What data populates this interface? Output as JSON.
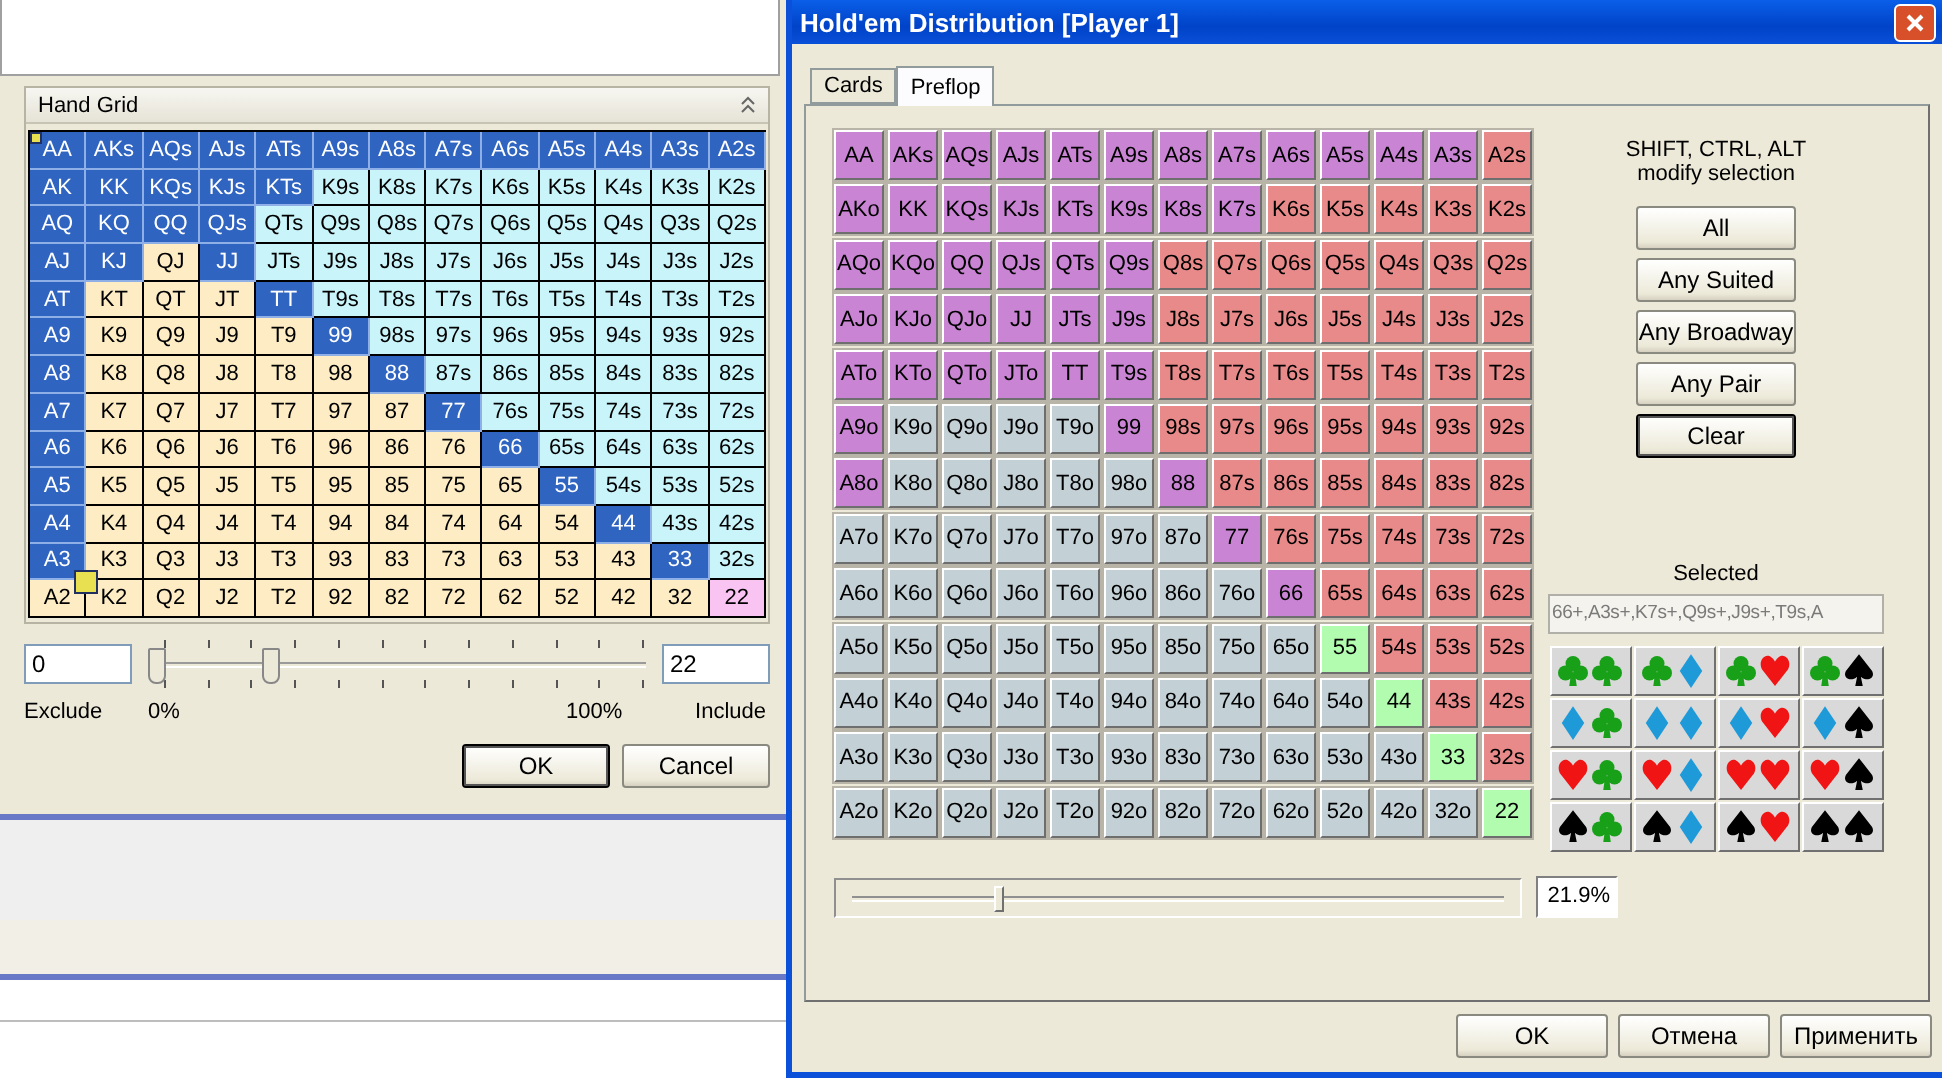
{
  "hand_grid_panel": {
    "header": "Hand Grid",
    "rows": [
      [
        {
          "label": "AA",
          "color": "#2f64c1"
        },
        {
          "label": "AKs",
          "color": "#2f64c1"
        },
        {
          "label": "AQs",
          "color": "#2f64c1"
        },
        {
          "label": "AJs",
          "color": "#2f64c1"
        },
        {
          "label": "ATs",
          "color": "#2f64c1"
        },
        {
          "label": "A9s",
          "color": "#2f64c1"
        },
        {
          "label": "A8s",
          "color": "#2f64c1"
        },
        {
          "label": "A7s",
          "color": "#2f64c1"
        },
        {
          "label": "A6s",
          "color": "#2f64c1"
        },
        {
          "label": "A5s",
          "color": "#2f64c1"
        },
        {
          "label": "A4s",
          "color": "#2f64c1"
        },
        {
          "label": "A3s",
          "color": "#2f64c1"
        },
        {
          "label": "A2s",
          "color": "#2f64c1"
        }
      ],
      [
        {
          "label": "AK",
          "color": "#2f64c1"
        },
        {
          "label": "KK",
          "color": "#2f64c1"
        },
        {
          "label": "KQs",
          "color": "#2f64c1"
        },
        {
          "label": "KJs",
          "color": "#2f64c1"
        },
        {
          "label": "KTs",
          "color": "#2f64c1"
        },
        {
          "label": "K9s",
          "color": "#c8f4fa"
        },
        {
          "label": "K8s",
          "color": "#c8f4fa"
        },
        {
          "label": "K7s",
          "color": "#c8f4fa"
        },
        {
          "label": "K6s",
          "color": "#c8f4fa"
        },
        {
          "label": "K5s",
          "color": "#c8f4fa"
        },
        {
          "label": "K4s",
          "color": "#c8f4fa"
        },
        {
          "label": "K3s",
          "color": "#c8f4fa"
        },
        {
          "label": "K2s",
          "color": "#c8f4fa"
        }
      ],
      [
        {
          "label": "AQ",
          "color": "#2f64c1"
        },
        {
          "label": "KQ",
          "color": "#2f64c1"
        },
        {
          "label": "QQ",
          "color": "#2f64c1"
        },
        {
          "label": "QJs",
          "color": "#2f64c1"
        },
        {
          "label": "QTs",
          "color": "#c8f4fa"
        },
        {
          "label": "Q9s",
          "color": "#c8f4fa"
        },
        {
          "label": "Q8s",
          "color": "#c8f4fa"
        },
        {
          "label": "Q7s",
          "color": "#c8f4fa"
        },
        {
          "label": "Q6s",
          "color": "#c8f4fa"
        },
        {
          "label": "Q5s",
          "color": "#c8f4fa"
        },
        {
          "label": "Q4s",
          "color": "#c8f4fa"
        },
        {
          "label": "Q3s",
          "color": "#c8f4fa"
        },
        {
          "label": "Q2s",
          "color": "#c8f4fa"
        }
      ],
      [
        {
          "label": "AJ",
          "color": "#2f64c1"
        },
        {
          "label": "KJ",
          "color": "#2f64c1"
        },
        {
          "label": "QJ",
          "color": "#fdecc4"
        },
        {
          "label": "JJ",
          "color": "#2f64c1"
        },
        {
          "label": "JTs",
          "color": "#c8f4fa"
        },
        {
          "label": "J9s",
          "color": "#c8f4fa"
        },
        {
          "label": "J8s",
          "color": "#c8f4fa"
        },
        {
          "label": "J7s",
          "color": "#c8f4fa"
        },
        {
          "label": "J6s",
          "color": "#c8f4fa"
        },
        {
          "label": "J5s",
          "color": "#c8f4fa"
        },
        {
          "label": "J4s",
          "color": "#c8f4fa"
        },
        {
          "label": "J3s",
          "color": "#c8f4fa"
        },
        {
          "label": "J2s",
          "color": "#c8f4fa"
        }
      ],
      [
        {
          "label": "AT",
          "color": "#2f64c1"
        },
        {
          "label": "KT",
          "color": "#fdecc4"
        },
        {
          "label": "QT",
          "color": "#fdecc4"
        },
        {
          "label": "JT",
          "color": "#fdecc4"
        },
        {
          "label": "TT",
          "color": "#2f64c1"
        },
        {
          "label": "T9s",
          "color": "#c8f4fa"
        },
        {
          "label": "T8s",
          "color": "#c8f4fa"
        },
        {
          "label": "T7s",
          "color": "#c8f4fa"
        },
        {
          "label": "T6s",
          "color": "#c8f4fa"
        },
        {
          "label": "T5s",
          "color": "#c8f4fa"
        },
        {
          "label": "T4s",
          "color": "#c8f4fa"
        },
        {
          "label": "T3s",
          "color": "#c8f4fa"
        },
        {
          "label": "T2s",
          "color": "#c8f4fa"
        }
      ],
      [
        {
          "label": "A9",
          "color": "#2f64c1"
        },
        {
          "label": "K9",
          "color": "#fdecc4"
        },
        {
          "label": "Q9",
          "color": "#fdecc4"
        },
        {
          "label": "J9",
          "color": "#fdecc4"
        },
        {
          "label": "T9",
          "color": "#fdecc4"
        },
        {
          "label": "99",
          "color": "#2f64c1"
        },
        {
          "label": "98s",
          "color": "#c8f4fa"
        },
        {
          "label": "97s",
          "color": "#c8f4fa"
        },
        {
          "label": "96s",
          "color": "#c8f4fa"
        },
        {
          "label": "95s",
          "color": "#c8f4fa"
        },
        {
          "label": "94s",
          "color": "#c8f4fa"
        },
        {
          "label": "93s",
          "color": "#c8f4fa"
        },
        {
          "label": "92s",
          "color": "#c8f4fa"
        }
      ],
      [
        {
          "label": "A8",
          "color": "#2f64c1"
        },
        {
          "label": "K8",
          "color": "#fdecc4"
        },
        {
          "label": "Q8",
          "color": "#fdecc4"
        },
        {
          "label": "J8",
          "color": "#fdecc4"
        },
        {
          "label": "T8",
          "color": "#fdecc4"
        },
        {
          "label": "98",
          "color": "#fdecc4"
        },
        {
          "label": "88",
          "color": "#2f64c1"
        },
        {
          "label": "87s",
          "color": "#c8f4fa"
        },
        {
          "label": "86s",
          "color": "#c8f4fa"
        },
        {
          "label": "85s",
          "color": "#c8f4fa"
        },
        {
          "label": "84s",
          "color": "#c8f4fa"
        },
        {
          "label": "83s",
          "color": "#c8f4fa"
        },
        {
          "label": "82s",
          "color": "#c8f4fa"
        }
      ],
      [
        {
          "label": "A7",
          "color": "#2f64c1"
        },
        {
          "label": "K7",
          "color": "#fdecc4"
        },
        {
          "label": "Q7",
          "color": "#fdecc4"
        },
        {
          "label": "J7",
          "color": "#fdecc4"
        },
        {
          "label": "T7",
          "color": "#fdecc4"
        },
        {
          "label": "97",
          "color": "#fdecc4"
        },
        {
          "label": "87",
          "color": "#fdecc4"
        },
        {
          "label": "77",
          "color": "#2f64c1"
        },
        {
          "label": "76s",
          "color": "#c8f4fa"
        },
        {
          "label": "75s",
          "color": "#c8f4fa"
        },
        {
          "label": "74s",
          "color": "#c8f4fa"
        },
        {
          "label": "73s",
          "color": "#c8f4fa"
        },
        {
          "label": "72s",
          "color": "#c8f4fa"
        }
      ],
      [
        {
          "label": "A6",
          "color": "#2f64c1"
        },
        {
          "label": "K6",
          "color": "#fdecc4"
        },
        {
          "label": "Q6",
          "color": "#fdecc4"
        },
        {
          "label": "J6",
          "color": "#fdecc4"
        },
        {
          "label": "T6",
          "color": "#fdecc4"
        },
        {
          "label": "96",
          "color": "#fdecc4"
        },
        {
          "label": "86",
          "color": "#fdecc4"
        },
        {
          "label": "76",
          "color": "#fdecc4"
        },
        {
          "label": "66",
          "color": "#2f64c1"
        },
        {
          "label": "65s",
          "color": "#c8f4fa"
        },
        {
          "label": "64s",
          "color": "#c8f4fa"
        },
        {
          "label": "63s",
          "color": "#c8f4fa"
        },
        {
          "label": "62s",
          "color": "#c8f4fa"
        }
      ],
      [
        {
          "label": "A5",
          "color": "#2f64c1"
        },
        {
          "label": "K5",
          "color": "#fdecc4"
        },
        {
          "label": "Q5",
          "color": "#fdecc4"
        },
        {
          "label": "J5",
          "color": "#fdecc4"
        },
        {
          "label": "T5",
          "color": "#fdecc4"
        },
        {
          "label": "95",
          "color": "#fdecc4"
        },
        {
          "label": "85",
          "color": "#fdecc4"
        },
        {
          "label": "75",
          "color": "#fdecc4"
        },
        {
          "label": "65",
          "color": "#fdecc4"
        },
        {
          "label": "55",
          "color": "#2f64c1"
        },
        {
          "label": "54s",
          "color": "#c8f4fa"
        },
        {
          "label": "53s",
          "color": "#c8f4fa"
        },
        {
          "label": "52s",
          "color": "#c8f4fa"
        }
      ],
      [
        {
          "label": "A4",
          "color": "#2f64c1"
        },
        {
          "label": "K4",
          "color": "#fdecc4"
        },
        {
          "label": "Q4",
          "color": "#fdecc4"
        },
        {
          "label": "J4",
          "color": "#fdecc4"
        },
        {
          "label": "T4",
          "color": "#fdecc4"
        },
        {
          "label": "94",
          "color": "#fdecc4"
        },
        {
          "label": "84",
          "color": "#fdecc4"
        },
        {
          "label": "74",
          "color": "#fdecc4"
        },
        {
          "label": "64",
          "color": "#fdecc4"
        },
        {
          "label": "54",
          "color": "#fdecc4"
        },
        {
          "label": "44",
          "color": "#2f64c1"
        },
        {
          "label": "43s",
          "color": "#c8f4fa"
        },
        {
          "label": "42s",
          "color": "#c8f4fa"
        }
      ],
      [
        {
          "label": "A3",
          "color": "#2f64c1"
        },
        {
          "label": "K3",
          "color": "#fdecc4"
        },
        {
          "label": "Q3",
          "color": "#fdecc4"
        },
        {
          "label": "J3",
          "color": "#fdecc4"
        },
        {
          "label": "T3",
          "color": "#fdecc4"
        },
        {
          "label": "93",
          "color": "#fdecc4"
        },
        {
          "label": "83",
          "color": "#fdecc4"
        },
        {
          "label": "73",
          "color": "#fdecc4"
        },
        {
          "label": "63",
          "color": "#fdecc4"
        },
        {
          "label": "53",
          "color": "#fdecc4"
        },
        {
          "label": "43",
          "color": "#fdecc4"
        },
        {
          "label": "33",
          "color": "#2f64c1"
        },
        {
          "label": "32s",
          "color": "#c8f4fa"
        }
      ],
      [
        {
          "label": "A2",
          "color": "#fdecc4"
        },
        {
          "label": "K2",
          "color": "#fdecc4"
        },
        {
          "label": "Q2",
          "color": "#fdecc4"
        },
        {
          "label": "J2",
          "color": "#fdecc4"
        },
        {
          "label": "T2",
          "color": "#fdecc4"
        },
        {
          "label": "92",
          "color": "#fdecc4"
        },
        {
          "label": "82",
          "color": "#fdecc4"
        },
        {
          "label": "72",
          "color": "#fdecc4"
        },
        {
          "label": "62",
          "color": "#fdecc4"
        },
        {
          "label": "52",
          "color": "#fdecc4"
        },
        {
          "label": "42",
          "color": "#fdecc4"
        },
        {
          "label": "32",
          "color": "#fdecc4"
        },
        {
          "label": "22",
          "color": "#f9c4f2"
        }
      ]
    ],
    "exclude_field": {
      "value": "0"
    },
    "range_slider": {
      "thumbs": [
        {
          "level": 0
        },
        {
          "level": 0.24
        }
      ]
    },
    "include_field": {
      "value": "22"
    },
    "labels": {
      "exclude": "Exclude",
      "min": "0%",
      "max": "100%",
      "include": "Include"
    },
    "buttons": [
      "OK",
      "Cancel"
    ]
  },
  "dialog": {
    "title": "Hold'em Distribution [Player 1]",
    "tabs": [
      {
        "label": "Cards",
        "selected": false
      },
      {
        "label": "Preflop",
        "selected": true
      }
    ],
    "rows": [
      [
        {
          "label": "AA",
          "color": "#c985d3"
        },
        {
          "label": "AKs",
          "color": "#c985d3"
        },
        {
          "label": "AQs",
          "color": "#c985d3"
        },
        {
          "label": "AJs",
          "color": "#c985d3"
        },
        {
          "label": "ATs",
          "color": "#c985d3"
        },
        {
          "label": "A9s",
          "color": "#c985d3"
        },
        {
          "label": "A8s",
          "color": "#c985d3"
        },
        {
          "label": "A7s",
          "color": "#c985d3"
        },
        {
          "label": "A6s",
          "color": "#c985d3"
        },
        {
          "label": "A5s",
          "color": "#c985d3"
        },
        {
          "label": "A4s",
          "color": "#c985d3"
        },
        {
          "label": "A3s",
          "color": "#c985d3"
        },
        {
          "label": "A2s",
          "color": "#e88a8a"
        }
      ],
      [
        {
          "label": "AKo",
          "color": "#c985d3"
        },
        {
          "label": "KK",
          "color": "#c985d3"
        },
        {
          "label": "KQs",
          "color": "#c985d3"
        },
        {
          "label": "KJs",
          "color": "#c985d3"
        },
        {
          "label": "KTs",
          "color": "#c985d3"
        },
        {
          "label": "K9s",
          "color": "#c985d3"
        },
        {
          "label": "K8s",
          "color": "#c985d3"
        },
        {
          "label": "K7s",
          "color": "#c985d3"
        },
        {
          "label": "K6s",
          "color": "#e88a8a"
        },
        {
          "label": "K5s",
          "color": "#e88a8a"
        },
        {
          "label": "K4s",
          "color": "#e88a8a"
        },
        {
          "label": "K3s",
          "color": "#e88a8a"
        },
        {
          "label": "K2s",
          "color": "#e88a8a"
        }
      ],
      [
        {
          "label": "AQo",
          "color": "#c985d3"
        },
        {
          "label": "KQo",
          "color": "#c985d3"
        },
        {
          "label": "QQ",
          "color": "#c985d3"
        },
        {
          "label": "QJs",
          "color": "#c985d3"
        },
        {
          "label": "QTs",
          "color": "#c985d3"
        },
        {
          "label": "Q9s",
          "color": "#c985d3"
        },
        {
          "label": "Q8s",
          "color": "#e88a8a"
        },
        {
          "label": "Q7s",
          "color": "#e88a8a"
        },
        {
          "label": "Q6s",
          "color": "#e88a8a"
        },
        {
          "label": "Q5s",
          "color": "#e88a8a"
        },
        {
          "label": "Q4s",
          "color": "#e88a8a"
        },
        {
          "label": "Q3s",
          "color": "#e88a8a"
        },
        {
          "label": "Q2s",
          "color": "#e88a8a"
        }
      ],
      [
        {
          "label": "AJo",
          "color": "#c985d3"
        },
        {
          "label": "KJo",
          "color": "#c985d3"
        },
        {
          "label": "QJo",
          "color": "#c985d3"
        },
        {
          "label": "JJ",
          "color": "#c985d3"
        },
        {
          "label": "JTs",
          "color": "#c985d3"
        },
        {
          "label": "J9s",
          "color": "#c985d3"
        },
        {
          "label": "J8s",
          "color": "#e88a8a"
        },
        {
          "label": "J7s",
          "color": "#e88a8a"
        },
        {
          "label": "J6s",
          "color": "#e88a8a"
        },
        {
          "label": "J5s",
          "color": "#e88a8a"
        },
        {
          "label": "J4s",
          "color": "#e88a8a"
        },
        {
          "label": "J3s",
          "color": "#e88a8a"
        },
        {
          "label": "J2s",
          "color": "#e88a8a"
        }
      ],
      [
        {
          "label": "ATo",
          "color": "#c985d3"
        },
        {
          "label": "KTo",
          "color": "#c985d3"
        },
        {
          "label": "QTo",
          "color": "#c985d3"
        },
        {
          "label": "JTo",
          "color": "#c985d3"
        },
        {
          "label": "TT",
          "color": "#c985d3"
        },
        {
          "label": "T9s",
          "color": "#c985d3"
        },
        {
          "label": "T8s",
          "color": "#e88a8a"
        },
        {
          "label": "T7s",
          "color": "#e88a8a"
        },
        {
          "label": "T6s",
          "color": "#e88a8a"
        },
        {
          "label": "T5s",
          "color": "#e88a8a"
        },
        {
          "label": "T4s",
          "color": "#e88a8a"
        },
        {
          "label": "T3s",
          "color": "#e88a8a"
        },
        {
          "label": "T2s",
          "color": "#e88a8a"
        }
      ],
      [
        {
          "label": "A9o",
          "color": "#c985d3"
        },
        {
          "label": "K9o",
          "color": "#c3d0d6"
        },
        {
          "label": "Q9o",
          "color": "#c3d0d6"
        },
        {
          "label": "J9o",
          "color": "#c3d0d6"
        },
        {
          "label": "T9o",
          "color": "#c3d0d6"
        },
        {
          "label": "99",
          "color": "#c985d3"
        },
        {
          "label": "98s",
          "color": "#e88a8a"
        },
        {
          "label": "97s",
          "color": "#e88a8a"
        },
        {
          "label": "96s",
          "color": "#e88a8a"
        },
        {
          "label": "95s",
          "color": "#e88a8a"
        },
        {
          "label": "94s",
          "color": "#e88a8a"
        },
        {
          "label": "93s",
          "color": "#e88a8a"
        },
        {
          "label": "92s",
          "color": "#e88a8a"
        }
      ],
      [
        {
          "label": "A8o",
          "color": "#c985d3"
        },
        {
          "label": "K8o",
          "color": "#c3d0d6"
        },
        {
          "label": "Q8o",
          "color": "#c3d0d6"
        },
        {
          "label": "J8o",
          "color": "#c3d0d6"
        },
        {
          "label": "T8o",
          "color": "#c3d0d6"
        },
        {
          "label": "98o",
          "color": "#c3d0d6"
        },
        {
          "label": "88",
          "color": "#c985d3"
        },
        {
          "label": "87s",
          "color": "#e88a8a"
        },
        {
          "label": "86s",
          "color": "#e88a8a"
        },
        {
          "label": "85s",
          "color": "#e88a8a"
        },
        {
          "label": "84s",
          "color": "#e88a8a"
        },
        {
          "label": "83s",
          "color": "#e88a8a"
        },
        {
          "label": "82s",
          "color": "#e88a8a"
        }
      ],
      [
        {
          "label": "A7o",
          "color": "#c3d0d6"
        },
        {
          "label": "K7o",
          "color": "#c3d0d6"
        },
        {
          "label": "Q7o",
          "color": "#c3d0d6"
        },
        {
          "label": "J7o",
          "color": "#c3d0d6"
        },
        {
          "label": "T7o",
          "color": "#c3d0d6"
        },
        {
          "label": "97o",
          "color": "#c3d0d6"
        },
        {
          "label": "87o",
          "color": "#c3d0d6"
        },
        {
          "label": "77",
          "color": "#c985d3"
        },
        {
          "label": "76s",
          "color": "#e88a8a"
        },
        {
          "label": "75s",
          "color": "#e88a8a"
        },
        {
          "label": "74s",
          "color": "#e88a8a"
        },
        {
          "label": "73s",
          "color": "#e88a8a"
        },
        {
          "label": "72s",
          "color": "#e88a8a"
        }
      ],
      [
        {
          "label": "A6o",
          "color": "#c3d0d6"
        },
        {
          "label": "K6o",
          "color": "#c3d0d6"
        },
        {
          "label": "Q6o",
          "color": "#c3d0d6"
        },
        {
          "label": "J6o",
          "color": "#c3d0d6"
        },
        {
          "label": "T6o",
          "color": "#c3d0d6"
        },
        {
          "label": "96o",
          "color": "#c3d0d6"
        },
        {
          "label": "86o",
          "color": "#c3d0d6"
        },
        {
          "label": "76o",
          "color": "#c3d0d6"
        },
        {
          "label": "66",
          "color": "#c985d3"
        },
        {
          "label": "65s",
          "color": "#e88a8a"
        },
        {
          "label": "64s",
          "color": "#e88a8a"
        },
        {
          "label": "63s",
          "color": "#e88a8a"
        },
        {
          "label": "62s",
          "color": "#e88a8a"
        }
      ],
      [
        {
          "label": "A5o",
          "color": "#c3d0d6"
        },
        {
          "label": "K5o",
          "color": "#c3d0d6"
        },
        {
          "label": "Q5o",
          "color": "#c3d0d6"
        },
        {
          "label": "J5o",
          "color": "#c3d0d6"
        },
        {
          "label": "T5o",
          "color": "#c3d0d6"
        },
        {
          "label": "95o",
          "color": "#c3d0d6"
        },
        {
          "label": "85o",
          "color": "#c3d0d6"
        },
        {
          "label": "75o",
          "color": "#c3d0d6"
        },
        {
          "label": "65o",
          "color": "#c3d0d6"
        },
        {
          "label": "55",
          "color": "#b2fcb0"
        },
        {
          "label": "54s",
          "color": "#e88a8a"
        },
        {
          "label": "53s",
          "color": "#e88a8a"
        },
        {
          "label": "52s",
          "color": "#e88a8a"
        }
      ],
      [
        {
          "label": "A4o",
          "color": "#c3d0d6"
        },
        {
          "label": "K4o",
          "color": "#c3d0d6"
        },
        {
          "label": "Q4o",
          "color": "#c3d0d6"
        },
        {
          "label": "J4o",
          "color": "#c3d0d6"
        },
        {
          "label": "T4o",
          "color": "#c3d0d6"
        },
        {
          "label": "94o",
          "color": "#c3d0d6"
        },
        {
          "label": "84o",
          "color": "#c3d0d6"
        },
        {
          "label": "74o",
          "color": "#c3d0d6"
        },
        {
          "label": "64o",
          "color": "#c3d0d6"
        },
        {
          "label": "54o",
          "color": "#c3d0d6"
        },
        {
          "label": "44",
          "color": "#b2fcb0"
        },
        {
          "label": "43s",
          "color": "#e88a8a"
        },
        {
          "label": "42s",
          "color": "#e88a8a"
        }
      ],
      [
        {
          "label": "A3o",
          "color": "#c3d0d6"
        },
        {
          "label": "K3o",
          "color": "#c3d0d6"
        },
        {
          "label": "Q3o",
          "color": "#c3d0d6"
        },
        {
          "label": "J3o",
          "color": "#c3d0d6"
        },
        {
          "label": "T3o",
          "color": "#c3d0d6"
        },
        {
          "label": "93o",
          "color": "#c3d0d6"
        },
        {
          "label": "83o",
          "color": "#c3d0d6"
        },
        {
          "label": "73o",
          "color": "#c3d0d6"
        },
        {
          "label": "63o",
          "color": "#c3d0d6"
        },
        {
          "label": "53o",
          "color": "#c3d0d6"
        },
        {
          "label": "43o",
          "color": "#c3d0d6"
        },
        {
          "label": "33",
          "color": "#b2fcb0"
        },
        {
          "label": "32s",
          "color": "#e88a8a"
        }
      ],
      [
        {
          "label": "A2o",
          "color": "#c3d0d6"
        },
        {
          "label": "K2o",
          "color": "#c3d0d6"
        },
        {
          "label": "Q2o",
          "color": "#c3d0d6"
        },
        {
          "label": "J2o",
          "color": "#c3d0d6"
        },
        {
          "label": "T2o",
          "color": "#c3d0d6"
        },
        {
          "label": "92o",
          "color": "#c3d0d6"
        },
        {
          "label": "82o",
          "color": "#c3d0d6"
        },
        {
          "label": "72o",
          "color": "#c3d0d6"
        },
        {
          "label": "62o",
          "color": "#c3d0d6"
        },
        {
          "label": "52o",
          "color": "#c3d0d6"
        },
        {
          "label": "42o",
          "color": "#c3d0d6"
        },
        {
          "label": "32o",
          "color": "#c3d0d6"
        },
        {
          "label": "22",
          "color": "#b2fcb0"
        }
      ]
    ],
    "hint_lines": [
      "SHIFT, CTRL, ALT",
      "modify selection"
    ],
    "buttons": [
      {
        "label": "All",
        "focused": false
      },
      {
        "label": "Any Suited",
        "focused": false
      },
      {
        "label": "Any Broadway",
        "focused": false
      },
      {
        "label": "Any Pair",
        "focused": false
      },
      {
        "label": "Clear",
        "focused": true
      }
    ],
    "selected_label": "Selected",
    "selected_field": {
      "value": "66+,A3s+,K7s+,Q9s+,J9s+,T9s,A"
    },
    "range_slider": {
      "level": 0.22
    },
    "percent_field": {
      "value": "21.9%"
    },
    "footer_buttons": [
      "OK",
      "Отмена",
      "Применить"
    ]
  }
}
